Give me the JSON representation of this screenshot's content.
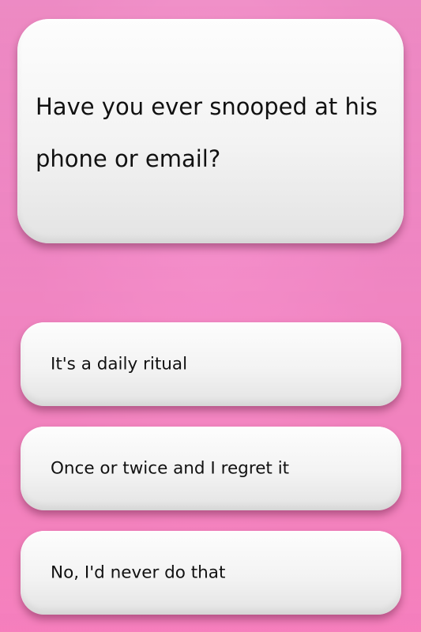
{
  "quiz": {
    "question": "Have you ever snooped at his phone or email?",
    "answers": [
      {
        "label": "It's a daily ritual"
      },
      {
        "label": "Once or twice and I regret it"
      },
      {
        "label": "No, I'd never do that"
      }
    ]
  },
  "colors": {
    "background": "#e0449a",
    "card": "#f3f3f3",
    "text": "#111111"
  }
}
